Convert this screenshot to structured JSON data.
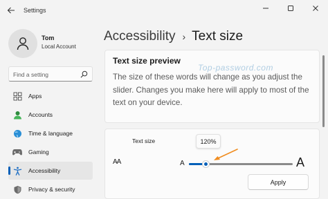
{
  "app": {
    "title": "Settings"
  },
  "window_controls": {
    "minimize": "minimize-icon",
    "maximize": "maximize-icon",
    "close": "close-icon"
  },
  "user": {
    "name": "Tom",
    "account_type": "Local Account"
  },
  "search": {
    "placeholder": "Find a setting"
  },
  "sidebar": {
    "items": [
      {
        "label": "Apps",
        "icon": "apps-icon",
        "active": false
      },
      {
        "label": "Accounts",
        "icon": "accounts-icon",
        "active": false
      },
      {
        "label": "Time & language",
        "icon": "time-language-icon",
        "active": false
      },
      {
        "label": "Gaming",
        "icon": "gaming-icon",
        "active": false
      },
      {
        "label": "Accessibility",
        "icon": "accessibility-icon",
        "active": true
      },
      {
        "label": "Privacy & security",
        "icon": "privacy-icon",
        "active": false
      }
    ]
  },
  "breadcrumb": {
    "parent": "Accessibility",
    "separator": "›",
    "current": "Text size"
  },
  "preview": {
    "title": "Text size preview",
    "text": "The size of these words will change as you adjust the slider. Changes you make here will apply to most of the text on your device.",
    "watermark": "Top-password.com"
  },
  "text_size": {
    "label": "Text size",
    "icon_text": "AA",
    "value_tooltip": "120%",
    "value_percent": 120,
    "min_percent": 100,
    "max_percent": 225,
    "small_a": "A",
    "large_a": "A",
    "apply_label": "Apply"
  },
  "colors": {
    "accent": "#005fb8",
    "annotation_arrow": "#f08c1f",
    "background": "#f3f3f3",
    "card": "#fbfbfb"
  }
}
